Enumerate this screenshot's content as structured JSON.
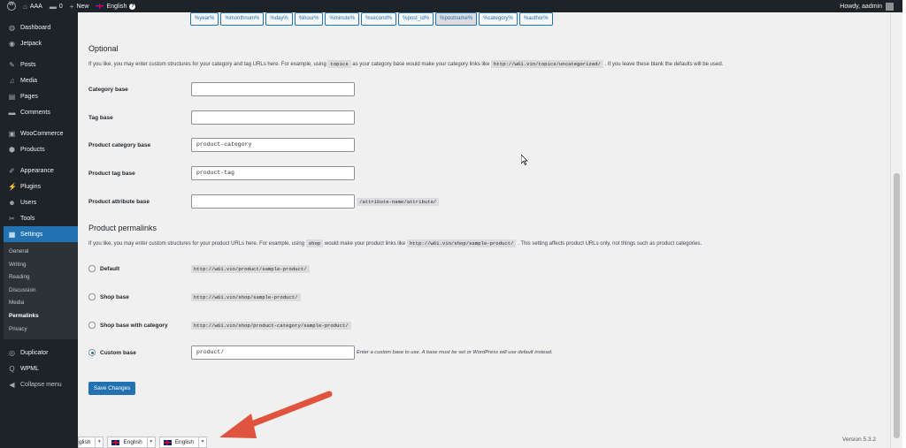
{
  "adminbar": {
    "site_name": "AAA",
    "comments_count": "0",
    "new_label": "New",
    "language": "English",
    "howdy": "Howdy, aadmin"
  },
  "sidebar": {
    "items": [
      {
        "label": "Dashboard",
        "icon": "dashboard-icon"
      },
      {
        "label": "Jetpack",
        "icon": "jetpack-icon"
      },
      {
        "label": "Posts",
        "icon": "pin-icon"
      },
      {
        "label": "Media",
        "icon": "media-icon"
      },
      {
        "label": "Pages",
        "icon": "pages-icon"
      },
      {
        "label": "Comments",
        "icon": "comment-icon"
      },
      {
        "label": "WooCommerce",
        "icon": "woocommerce-icon"
      },
      {
        "label": "Products",
        "icon": "products-icon"
      },
      {
        "label": "Appearance",
        "icon": "brush-icon"
      },
      {
        "label": "Plugins",
        "icon": "plugin-icon"
      },
      {
        "label": "Users",
        "icon": "users-icon"
      },
      {
        "label": "Tools",
        "icon": "wrench-icon"
      },
      {
        "label": "Settings",
        "icon": "settings-icon"
      }
    ],
    "submenu": [
      "General",
      "Writing",
      "Reading",
      "Discussion",
      "Media",
      "Permalinks",
      "Privacy"
    ],
    "bottom_items": [
      {
        "label": "Duplicator",
        "icon": "duplicator-icon"
      },
      {
        "label": "WPML",
        "icon": "wpml-icon"
      },
      {
        "label": "Collapse menu",
        "icon": "collapse-icon"
      }
    ]
  },
  "structure_tags": [
    "%year%",
    "%monthnum%",
    "%day%",
    "%hour%",
    "%minute%",
    "%second%",
    "%post_id%",
    "%postname%",
    "%category%",
    "%author%"
  ],
  "optional": {
    "heading": "Optional",
    "desc_before": "If you like, you may enter custom structures for your category and tag URLs here. For example, using",
    "desc_code": "topics",
    "desc_middle": "as your category base would make your category links like",
    "desc_url": "http://w61.vin/topics/uncategorized/",
    "desc_after": ". If you leave these blank the defaults will be used.",
    "fields": [
      {
        "label": "Category base",
        "value": ""
      },
      {
        "label": "Tag base",
        "value": ""
      },
      {
        "label": "Product category base",
        "value": "product-category"
      },
      {
        "label": "Product tag base",
        "value": "product-tag"
      },
      {
        "label": "Product attribute base",
        "value": ""
      }
    ],
    "attribute_hint": "/attribute-name/attribute/"
  },
  "product_permalinks": {
    "heading": "Product permalinks",
    "desc_before": "If you like, you may enter custom structures for your product URLs here. For example, using",
    "desc_code": "shop",
    "desc_middle": "would make your product links like",
    "desc_url": "http://w61.vin/shop/sample-product/",
    "desc_after": ". This setting affects product URLs only, not things such as product categories.",
    "options": [
      {
        "label": "Default",
        "example": "http://w61.vin/product/sample-product/"
      },
      {
        "label": "Shop base",
        "example": "http://w61.vin/shop/sample-product/"
      },
      {
        "label": "Shop base with category",
        "example": "http://w61.vin/shop/product-category/sample-product/"
      },
      {
        "label": "Custom base",
        "value": "product/"
      }
    ],
    "custom_note": "Enter a custom base to use. A base must be set or WordPress will use default instead."
  },
  "save_label": "Save Changes",
  "language_switchers": [
    "glish",
    "English",
    "English"
  ],
  "version": "Version 5.3.2",
  "colors": {
    "accent": "#2271b1",
    "arrow": "#e0533e",
    "sidebar": "#1d2327"
  }
}
